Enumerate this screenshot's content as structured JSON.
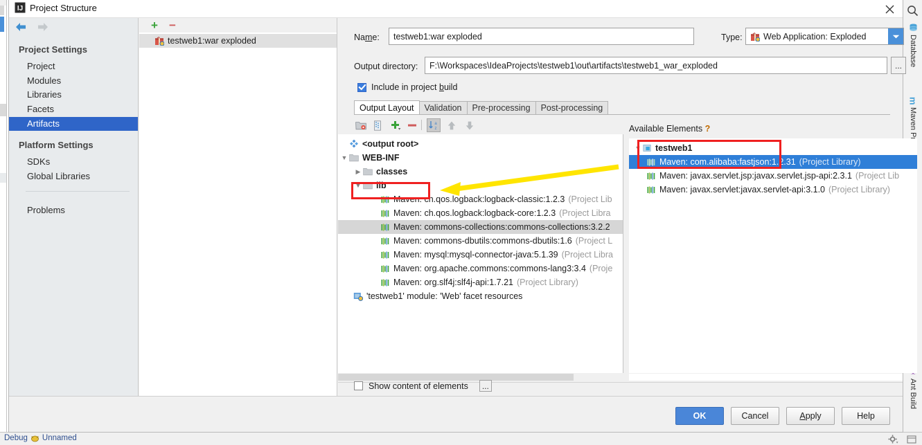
{
  "window": {
    "title": "Project Structure",
    "app_icon": "intellij-idea-icon",
    "close_label": "✕"
  },
  "sidebar": {
    "nav": {
      "back": "back-arrow",
      "forward": "forward-arrow"
    },
    "groups": [
      {
        "label": "Project Settings",
        "items": [
          "Project",
          "Modules",
          "Libraries",
          "Facets",
          "Artifacts"
        ]
      },
      {
        "label": "Platform Settings",
        "items": [
          "SDKs",
          "Global Libraries"
        ]
      }
    ],
    "selected": "Artifacts",
    "problems": "Problems"
  },
  "artifacts_panel": {
    "add_label": "+",
    "remove_label": "−",
    "items": [
      {
        "label": "testweb1:war exploded",
        "icon": "artifact-icon",
        "selected": true
      }
    ]
  },
  "form": {
    "name_label": "Name:",
    "name_value": "testweb1:war exploded",
    "type_label": "Type:",
    "type_value": "Web Application: Exploded",
    "type_icon": "artifact-icon",
    "output_label": "Output directory:",
    "output_value": "F:\\Workspaces\\IdeaProjects\\testweb1\\out\\artifacts\\testweb1_war_exploded",
    "browse_label": "...",
    "include_checkbox": {
      "label": "Include in project build",
      "checked": true
    }
  },
  "tabs": [
    {
      "label": "Output Layout",
      "active": true
    },
    {
      "label": "Validation",
      "active": false
    },
    {
      "label": "Pre-processing",
      "active": false
    },
    {
      "label": "Post-processing",
      "active": false
    }
  ],
  "output_toolbar": [
    {
      "name": "create-directory-icon"
    },
    {
      "name": "create-archive-icon"
    },
    {
      "name": "add-copy-icon"
    },
    {
      "name": "remove-icon"
    },
    {
      "name": "sort-alphabetically-icon"
    },
    {
      "name": "move-up-icon"
    },
    {
      "name": "move-down-icon"
    }
  ],
  "output_tree": [
    {
      "indent": 0,
      "twisty": "",
      "icon": "output-root-icon",
      "text": "<output root>",
      "dim": ""
    },
    {
      "indent": 0,
      "twisty": "▼",
      "icon": "folder-icon",
      "text": "WEB-INF",
      "dim": ""
    },
    {
      "indent": 1,
      "twisty": "▶",
      "icon": "folder-icon",
      "text": "classes",
      "dim": ""
    },
    {
      "indent": 1,
      "twisty": "▼",
      "icon": "folder-icon",
      "text": "lib",
      "dim": ""
    },
    {
      "indent": 3,
      "twisty": "",
      "icon": "library-icon",
      "text": "Maven: ch.qos.logback:logback-classic:1.2.3",
      "dim": "(Project Lib"
    },
    {
      "indent": 3,
      "twisty": "",
      "icon": "library-icon",
      "text": "Maven: ch.qos.logback:logback-core:1.2.3",
      "dim": "(Project Libra"
    },
    {
      "indent": 3,
      "twisty": "",
      "icon": "library-icon",
      "text": "Maven: commons-collections:commons-collections:3.2.2",
      "dim": "",
      "selected": true
    },
    {
      "indent": 3,
      "twisty": "",
      "icon": "library-icon",
      "text": "Maven: commons-dbutils:commons-dbutils:1.6",
      "dim": "(Project L"
    },
    {
      "indent": 3,
      "twisty": "",
      "icon": "library-icon",
      "text": "Maven: mysql:mysql-connector-java:5.1.39",
      "dim": "(Project Libra"
    },
    {
      "indent": 3,
      "twisty": "",
      "icon": "library-icon",
      "text": "Maven: org.apache.commons:commons-lang3:3.4",
      "dim": "(Proje"
    },
    {
      "indent": 3,
      "twisty": "",
      "icon": "library-icon",
      "text": "Maven: org.slf4j:slf4j-api:1.7.21",
      "dim": "(Project Library)"
    },
    {
      "indent": 0,
      "twisty": "",
      "icon": "facet-icon",
      "text": "'testweb1' module: 'Web' facet resources",
      "dim": ""
    }
  ],
  "available": {
    "title": "Available Elements",
    "help": "?",
    "tree": [
      {
        "indent": 0,
        "twisty": "▼",
        "icon": "module-icon",
        "text": "testweb1",
        "dim": ""
      },
      {
        "indent": 1,
        "twisty": "",
        "icon": "library-icon",
        "text": "Maven: com.alibaba:fastjson:1.2.31",
        "dim": "(Project Library)",
        "selected": true
      },
      {
        "indent": 1,
        "twisty": "",
        "icon": "library-icon",
        "text": "Maven: javax.servlet.jsp:javax.servlet.jsp-api:2.3.1",
        "dim": "(Project Lib"
      },
      {
        "indent": 1,
        "twisty": "",
        "icon": "library-icon",
        "text": "Maven: javax.servlet:javax.servlet-api:3.1.0",
        "dim": "(Project Library)"
      }
    ]
  },
  "show_content": {
    "label": "Show content of elements",
    "checked": false,
    "options_label": "..."
  },
  "buttons": [
    {
      "label": "OK",
      "primary": true
    },
    {
      "label": "Cancel",
      "primary": false
    },
    {
      "label": "Apply",
      "primary": false,
      "mnemonic": "A"
    },
    {
      "label": "Help",
      "primary": false
    }
  ],
  "ide": {
    "right_tabs": [
      "Database",
      "Maven Projects",
      "Ant Build"
    ],
    "search_icon": "search-icon",
    "status_left": "Debug",
    "status_config": "Unnamed",
    "status_gear": "settings-gear-icon"
  },
  "annotations": {
    "rect_lib": "highlight-lib-folder",
    "rect_fastjson": "highlight-fastjson-entry",
    "arrow": "yellow-pointer-arrow",
    "color_rect": "#ef2020",
    "color_arrow": "#ffe500"
  }
}
